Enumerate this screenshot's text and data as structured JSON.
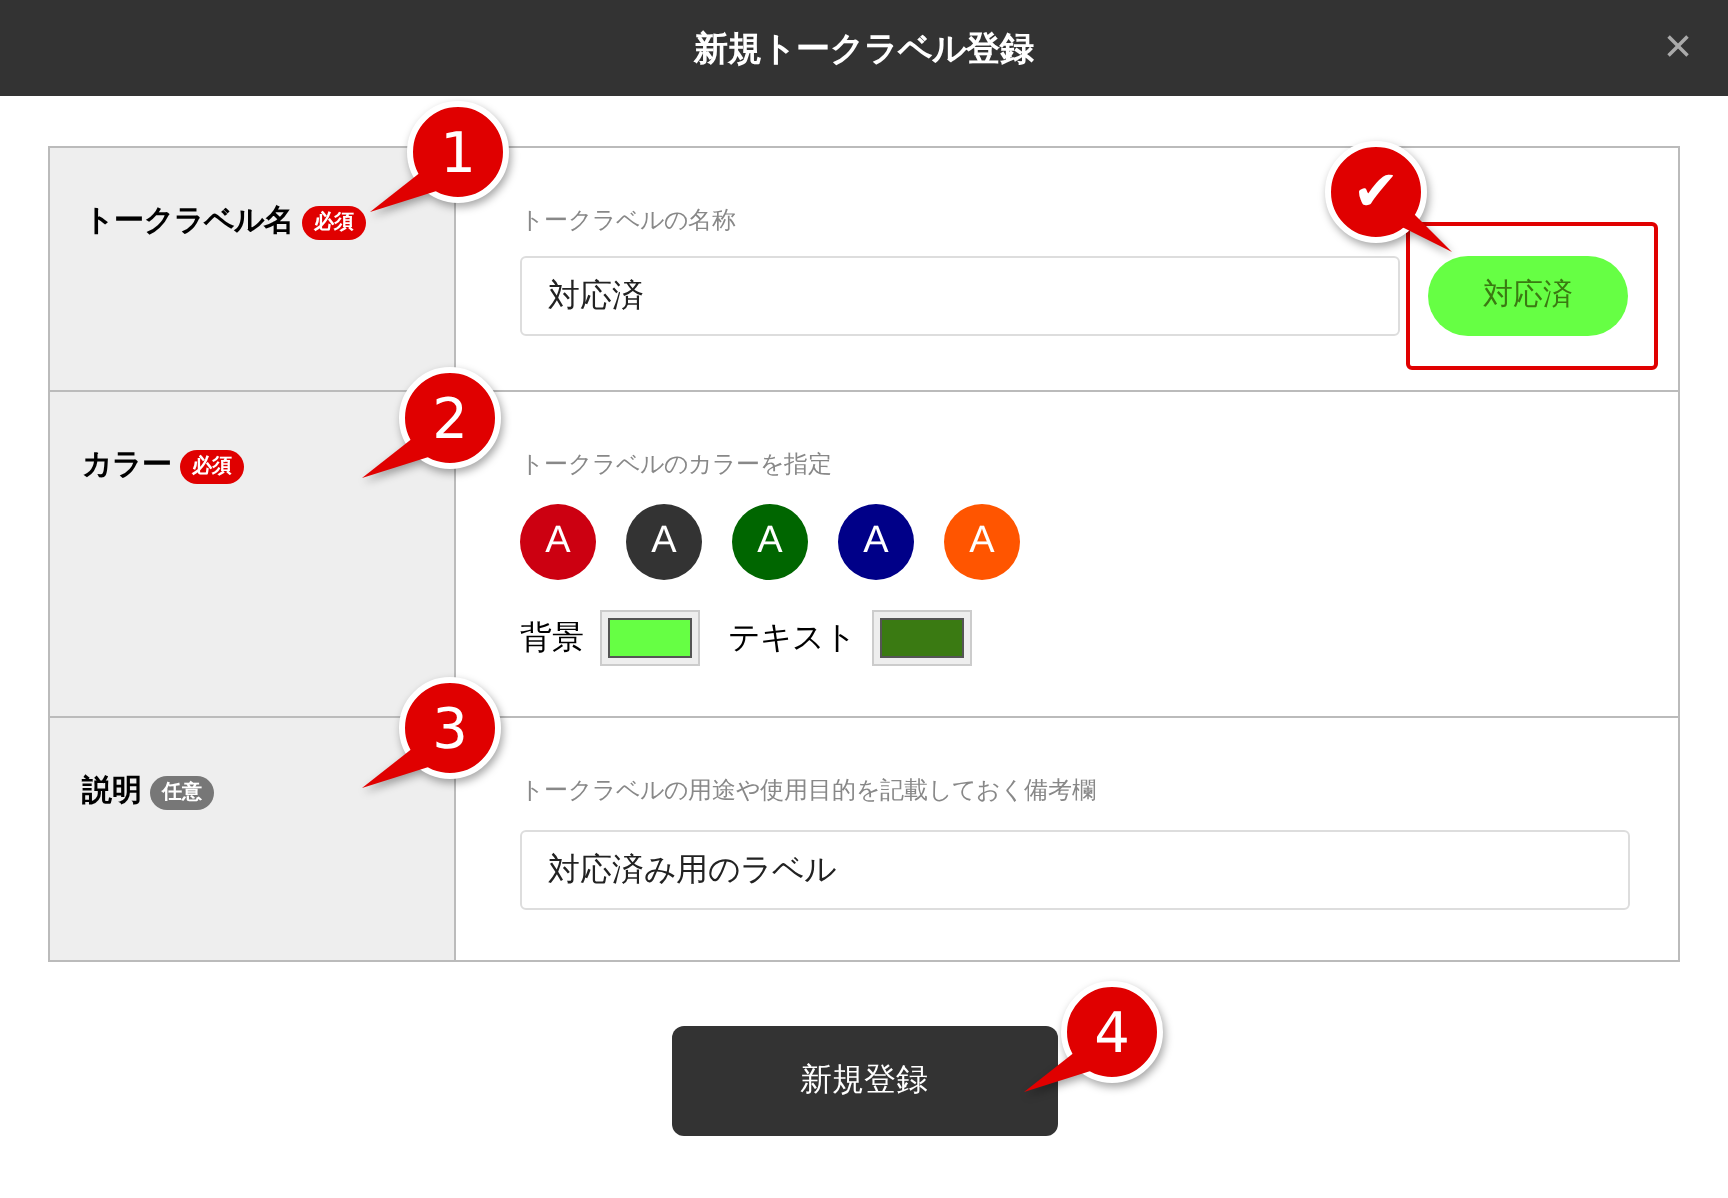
{
  "dialog": {
    "title": "新規トークラベル登録",
    "close": "×"
  },
  "rows": [
    {
      "kind": "name",
      "label": "トークラベル名",
      "badge": {
        "text": "必須",
        "kind": "required"
      },
      "hint": "トークラベルの名称",
      "value": "対応済",
      "preview": "対応済"
    },
    {
      "kind": "color",
      "label": "カラー",
      "badge": {
        "text": "必須",
        "kind": "required"
      },
      "hint": "トークラベルのカラーを指定",
      "swatches": [
        {
          "text": "A",
          "color": "#cc0011"
        },
        {
          "text": "A",
          "color": "#333333"
        },
        {
          "text": "A",
          "color": "#006600"
        },
        {
          "text": "A",
          "color": "#000088"
        },
        {
          "text": "A",
          "color": "#ff5500"
        }
      ],
      "pickers": [
        {
          "label": "背景",
          "color": "#66ff44"
        },
        {
          "label": "テキスト",
          "color": "#3a7a12"
        }
      ]
    },
    {
      "kind": "text",
      "label": "説明",
      "badge": {
        "text": "任意",
        "kind": "optional"
      },
      "hint": "トークラベルの用途や使用目的を記載しておく備考欄",
      "value": "対応済み用のラベル"
    }
  ],
  "submit": "新規登録",
  "callouts": [
    {
      "label": "1"
    },
    {
      "label": "2"
    },
    {
      "label": "3"
    },
    {
      "label": "4"
    },
    {
      "label": "✔"
    }
  ]
}
